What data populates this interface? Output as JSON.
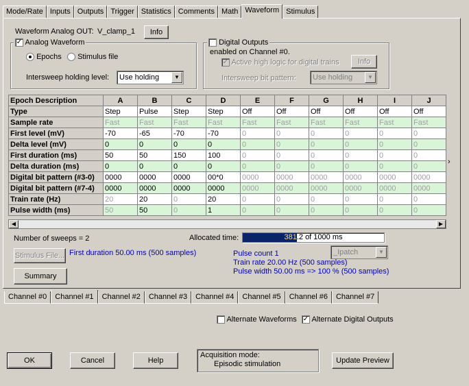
{
  "top_tabs": [
    "Mode/Rate",
    "Inputs",
    "Outputs",
    "Trigger",
    "Statistics",
    "Comments",
    "Math",
    "Waveform",
    "Stimulus"
  ],
  "active_tab": "Waveform",
  "waveform_out_label": "Waveform Analog OUT:",
  "waveform_out_value": "V_clamp_1",
  "info_button": "Info",
  "analog_waveform_label": "Analog Waveform",
  "epochs_label": "Epochs",
  "stimulus_file_label": "Stimulus file",
  "intersweep_holding_label": "Intersweep holding level:",
  "intersweep_holding_value": "Use holding",
  "digital_outputs_label": "Digital Outputs",
  "digital_enabled_text": "enabled on Channel #0.",
  "active_high_label": "Active high logic for digital trains",
  "digital_info_button": "Info",
  "intersweep_bit_label": "Intersweep bit pattern:",
  "intersweep_bit_value": "Use holding",
  "table": {
    "corner": "Epoch Description",
    "columns": [
      "A",
      "B",
      "C",
      "D",
      "E",
      "F",
      "G",
      "H",
      "I",
      "J"
    ],
    "rows": [
      {
        "label": "Type",
        "style": "white",
        "cells": [
          "Step",
          "Pulse",
          "Step",
          "Step",
          "Off",
          "Off",
          "Off",
          "Off",
          "Off",
          "Off"
        ],
        "grey": [
          false,
          false,
          false,
          false,
          false,
          false,
          false,
          false,
          false,
          false
        ]
      },
      {
        "label": "Sample rate",
        "style": "green",
        "cells": [
          "Fast",
          "Fast",
          "Fast",
          "Fast",
          "Fast",
          "Fast",
          "Fast",
          "Fast",
          "Fast",
          "Fast"
        ],
        "grey": [
          true,
          true,
          true,
          true,
          true,
          true,
          true,
          true,
          true,
          true
        ]
      },
      {
        "label": "First level (mV)",
        "style": "white",
        "cells": [
          "-70",
          "-65",
          "-70",
          "-70",
          "0",
          "0",
          "0",
          "0",
          "0",
          "0"
        ],
        "grey": [
          false,
          false,
          false,
          false,
          true,
          true,
          true,
          true,
          true,
          true
        ]
      },
      {
        "label": "Delta level (mV)",
        "style": "green",
        "cells": [
          "0",
          "0",
          "0",
          "0",
          "0",
          "0",
          "0",
          "0",
          "0",
          "0"
        ],
        "grey": [
          false,
          false,
          false,
          false,
          true,
          true,
          true,
          true,
          true,
          true
        ]
      },
      {
        "label": "First duration (ms)",
        "style": "white",
        "cells": [
          "50",
          "50",
          "150",
          "100",
          "0",
          "0",
          "0",
          "0",
          "0",
          "0"
        ],
        "grey": [
          false,
          false,
          false,
          false,
          true,
          true,
          true,
          true,
          true,
          true
        ]
      },
      {
        "label": "Delta duration (ms)",
        "style": "green",
        "cells": [
          "0",
          "0",
          "0",
          "0",
          "0",
          "0",
          "0",
          "0",
          "0",
          "0"
        ],
        "grey": [
          false,
          false,
          false,
          false,
          true,
          true,
          true,
          true,
          true,
          true
        ]
      },
      {
        "label": "Digital bit pattern (#3-0)",
        "style": "white",
        "cells": [
          "0000",
          "0000",
          "0000",
          "00*0",
          "0000",
          "0000",
          "0000",
          "0000",
          "0000",
          "0000"
        ],
        "grey": [
          false,
          false,
          false,
          false,
          true,
          true,
          true,
          true,
          true,
          true
        ]
      },
      {
        "label": "Digital bit pattern (#7-4)",
        "style": "green",
        "cells": [
          "0000",
          "0000",
          "0000",
          "0000",
          "0000",
          "0000",
          "0000",
          "0000",
          "0000",
          "0000"
        ],
        "grey": [
          false,
          false,
          false,
          false,
          true,
          true,
          true,
          true,
          true,
          true
        ]
      },
      {
        "label": "Train rate (Hz)",
        "style": "white",
        "cells": [
          "20",
          "20",
          "0",
          "20",
          "0",
          "0",
          "0",
          "0",
          "0",
          "0"
        ],
        "grey": [
          true,
          false,
          true,
          false,
          true,
          true,
          true,
          true,
          true,
          true
        ]
      },
      {
        "label": "Pulse width (ms)",
        "style": "green",
        "cells": [
          "50",
          "50",
          "0",
          "1",
          "0",
          "0",
          "0",
          "0",
          "0",
          "0"
        ],
        "grey": [
          true,
          false,
          true,
          false,
          true,
          true,
          true,
          true,
          true,
          true
        ]
      }
    ]
  },
  "sweeps_text": "Number of sweeps = 2",
  "allocated_label": "Allocated time:",
  "allocated_text": "381.2 of 1000 ms",
  "allocated_fraction": 0.3812,
  "stimulus_file_button": "Stimulus File...",
  "summary_button": "Summary",
  "first_duration_info": "First duration 50.00 ms (500 samples)",
  "ipatch_value": "_Ipatch",
  "pulse_count": "Pulse count 1",
  "train_rate_info": "Train rate 20.00 Hz (500 samples)",
  "pulse_width_info": "Pulse width 50.00 ms => 100 % (500 samples)",
  "channel_tabs": [
    "Channel #0",
    "Channel #1",
    "Channel #2",
    "Channel #3",
    "Channel #4",
    "Channel #5",
    "Channel #6",
    "Channel #7"
  ],
  "active_channel": "Channel #1",
  "alternate_waveforms_label": "Alternate Waveforms",
  "alternate_digital_label": "Alternate Digital Outputs",
  "ok_button": "OK",
  "cancel_button": "Cancel",
  "help_button": "Help",
  "acq_mode_label": "Acquisition mode:",
  "acq_mode_value": "Episodic stimulation",
  "update_preview_button": "Update Preview",
  "colors": {
    "allocated_bar": "#0a246a",
    "info_text": "#0000c0",
    "green_row": "#d8f5d8"
  }
}
